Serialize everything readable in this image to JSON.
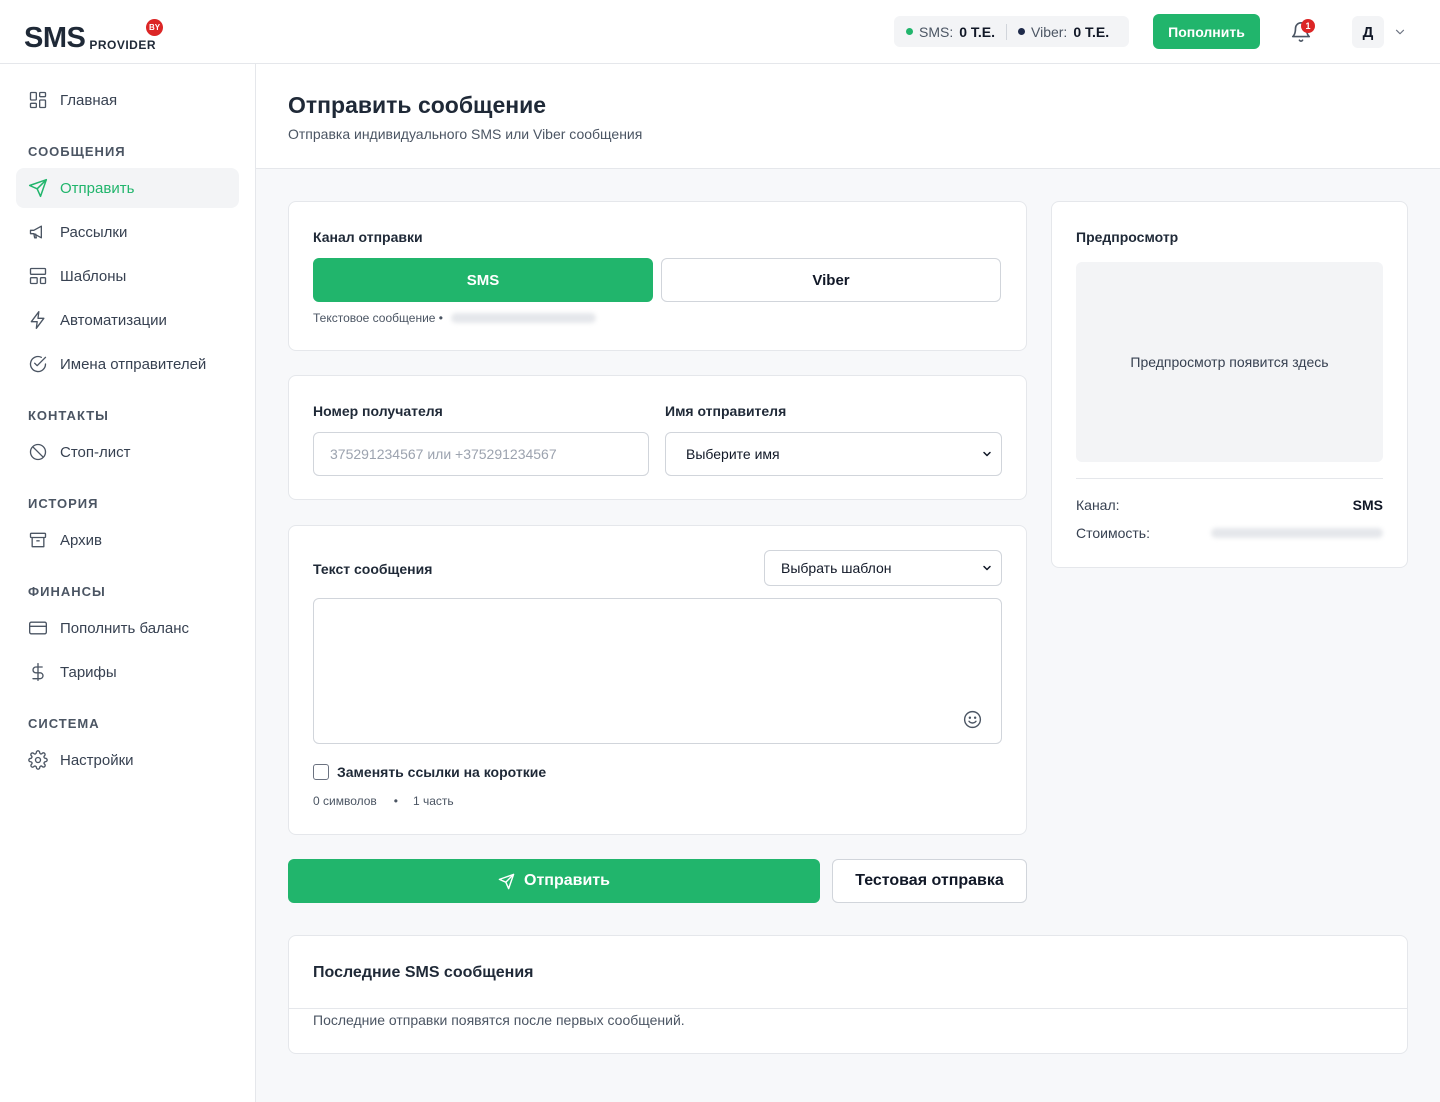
{
  "header": {
    "logo_main": "SMS",
    "logo_sub": "PROVIDER",
    "logo_badge": "BY",
    "balance": [
      {
        "label": "SMS:",
        "value": "0 Т.Е.",
        "color": "#21b56c"
      },
      {
        "label": "Viber:",
        "value": "0 Т.Е.",
        "color": "#1e2a4a"
      }
    ],
    "topup_label": "Пополнить",
    "notif_count": "1",
    "avatar_letter": "Д"
  },
  "sidebar": {
    "home": "Главная",
    "sections": {
      "messages": "СООБЩЕНИЯ",
      "contacts": "КОНТАКТЫ",
      "history": "ИСТОРИЯ",
      "finance": "ФИНАНСЫ",
      "system": "СИСТЕМА"
    },
    "items": {
      "send": "Отправить",
      "mailings": "Рассылки",
      "templates": "Шаблоны",
      "automations": "Автоматизации",
      "senders": "Имена отправителей",
      "stoplist": "Стоп-лист",
      "archive": "Архив",
      "topup": "Пополнить баланс",
      "tariffs": "Тарифы",
      "settings": "Настройки"
    }
  },
  "page": {
    "title": "Отправить сообщение",
    "subtitle": "Отправка индивидуального SMS или Viber сообщения"
  },
  "channel": {
    "label": "Канал отправки",
    "options": [
      "SMS",
      "Viber"
    ],
    "selected": "SMS",
    "note": "Текстовое сообщение •"
  },
  "recipient": {
    "label": "Номер получателя",
    "placeholder": "375291234567 или +375291234567"
  },
  "sender": {
    "label": "Имя отправителя",
    "selected": "Выберите имя"
  },
  "message": {
    "label": "Текст сообщения",
    "template_select": "Выбрать шаблон",
    "shorten_links": "Заменять ссылки на короткие",
    "chars": "0 символов",
    "sep": "•",
    "parts": "1 часть"
  },
  "actions": {
    "send": "Отправить",
    "test": "Тестовая отправка"
  },
  "preview": {
    "title": "Предпросмотр",
    "placeholder": "Предпросмотр появится здесь",
    "channel_label": "Канал:",
    "channel_value": "SMS",
    "cost_label": "Стоимость:"
  },
  "recent": {
    "title": "Последние SMS сообщения",
    "empty": "Последние отправки появятся после первых сообщений."
  }
}
